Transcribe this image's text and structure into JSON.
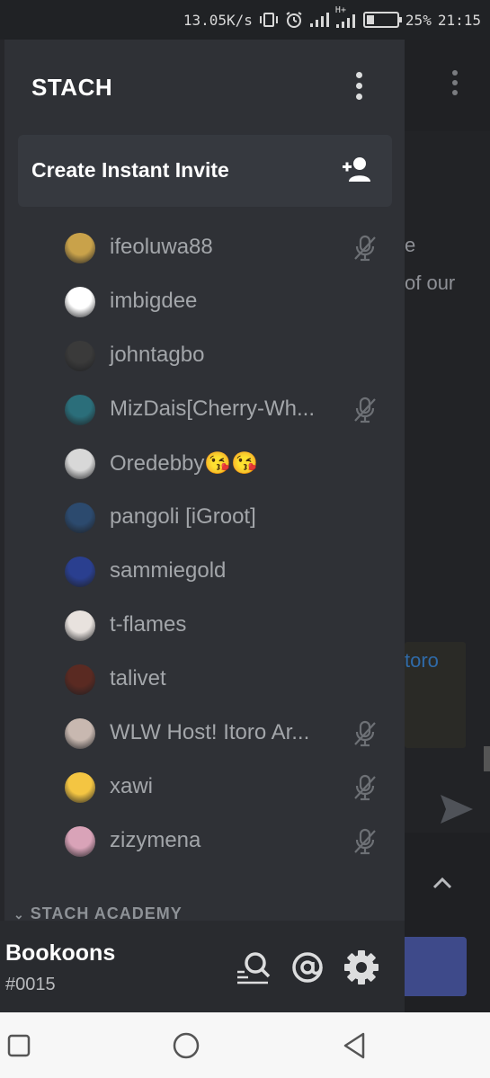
{
  "status_bar": {
    "speed": "13.05K/s",
    "network_type": "H+",
    "battery_percent": "25%",
    "time": "21:15",
    "icons": [
      "vibrate-icon",
      "alarm-icon",
      "signal-icon",
      "signal-hplus-icon",
      "battery-icon"
    ]
  },
  "server": {
    "name": "STACH",
    "menu_icon": "more-vertical-icon"
  },
  "invite": {
    "label": "Create Instant Invite",
    "icon": "add-person-icon"
  },
  "members": [
    {
      "name": "ifeoluwa88",
      "muted": true,
      "avatar_color": "#c9a24a"
    },
    {
      "name": "imbigdee",
      "muted": false,
      "avatar_color": "#ffffff"
    },
    {
      "name": "johntagbo",
      "muted": false,
      "avatar_color": "#3a3a3a"
    },
    {
      "name": "MizDais[Cherry-Wh...",
      "muted": true,
      "avatar_color": "#2b6e7a"
    },
    {
      "name": "Oredebby😘😘",
      "muted": false,
      "avatar_color": "#d8d8d8"
    },
    {
      "name": "pangoli [iGroot]",
      "muted": false,
      "avatar_color": "#2c4a6e"
    },
    {
      "name": "sammiegold",
      "muted": false,
      "avatar_color": "#2a3f8f"
    },
    {
      "name": "t-flames",
      "muted": false,
      "avatar_color": "#e8e2de"
    },
    {
      "name": "talivet",
      "muted": false,
      "avatar_color": "#5a2a22"
    },
    {
      "name": "WLW Host! Itoro Ar...",
      "muted": true,
      "avatar_color": "#c8b8b0"
    },
    {
      "name": "xawi",
      "muted": true,
      "avatar_color": "#f4c542"
    },
    {
      "name": "zizymena",
      "muted": true,
      "avatar_color": "#d9a3b8"
    }
  ],
  "category": {
    "label": "STACH ACADEMY"
  },
  "background": {
    "text1": "e",
    "text2": "of our",
    "embed_link": "toro"
  },
  "user": {
    "username": "Bookoons",
    "discriminator": "#0015",
    "icons": [
      "search-icon",
      "mention-icon",
      "settings-icon"
    ]
  },
  "navbar": {
    "icons": [
      "recents-icon",
      "home-icon",
      "back-icon"
    ]
  }
}
